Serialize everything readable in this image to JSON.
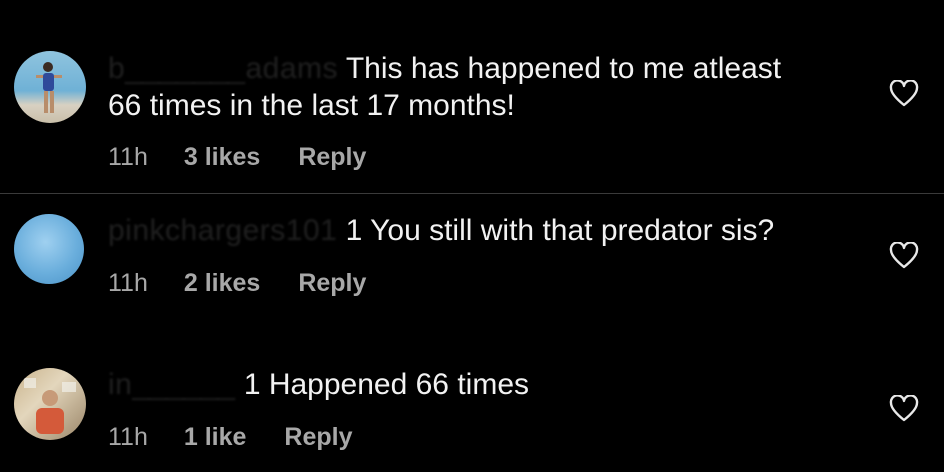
{
  "comments": [
    {
      "username": "b_______adams",
      "text_line1": "This has happened to me atleast",
      "text_line2": "66 times in the last 17 months!",
      "time": "11h",
      "likes": "3 likes",
      "reply": "Reply",
      "avatar_icon": "avatar-photo-beach"
    },
    {
      "username": "pinkchargers101",
      "text_line1": "1 You still with that predator sis?",
      "time": "11h",
      "likes": "2 likes",
      "reply": "Reply",
      "avatar_icon": "avatar-photo-sky"
    },
    {
      "username": "in______",
      "text_line1": "1 Happened 66 times",
      "time": "11h",
      "likes": "1 like",
      "reply": "Reply",
      "avatar_icon": "avatar-photo-person"
    }
  ],
  "heart_icon": "heart-outline-icon",
  "colors": {
    "background": "#000000",
    "text": "#f2f2f2",
    "meta": "#a8a8a8",
    "divider": "#3a3a3a"
  }
}
